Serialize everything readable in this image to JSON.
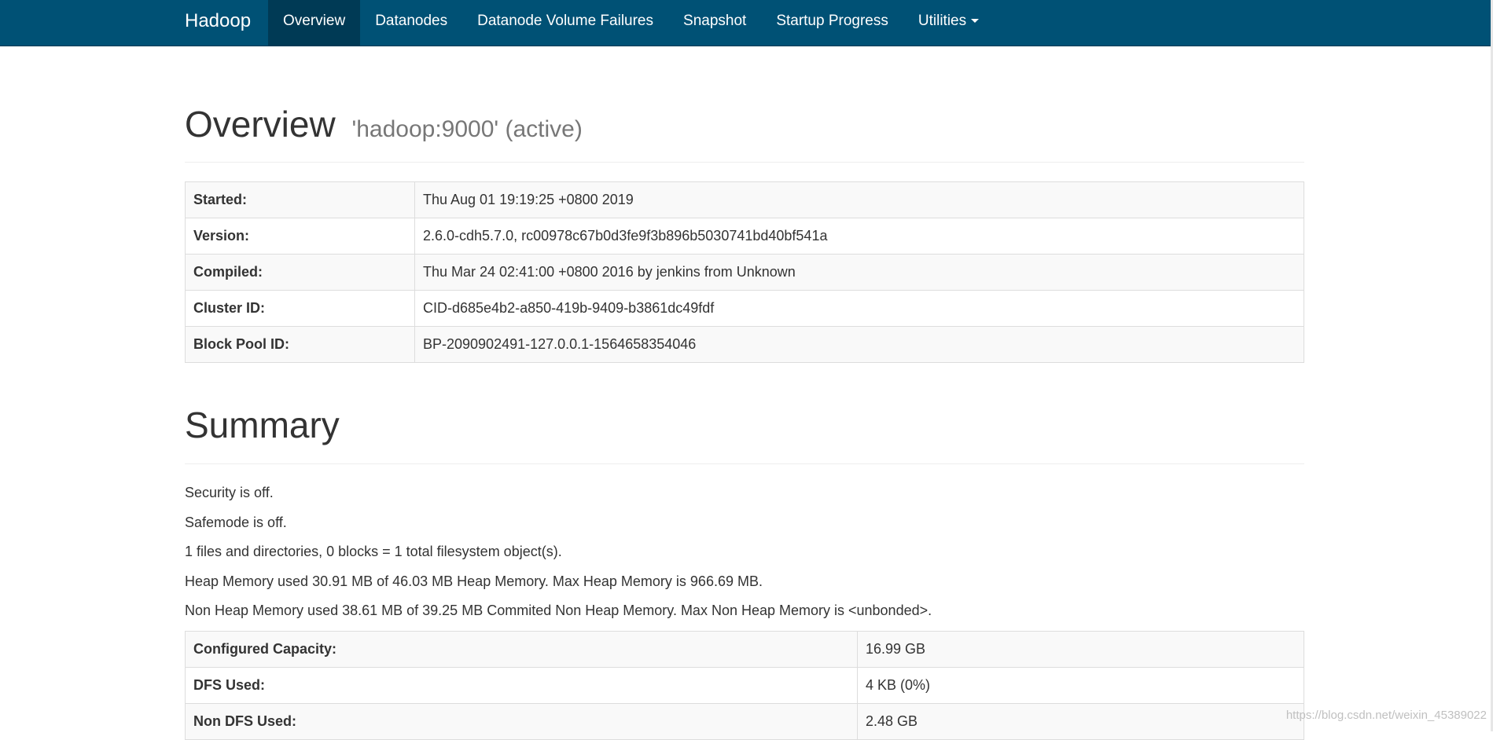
{
  "nav": {
    "brand": "Hadoop",
    "items": [
      {
        "label": "Overview",
        "active": true
      },
      {
        "label": "Datanodes",
        "active": false
      },
      {
        "label": "Datanode Volume Failures",
        "active": false
      },
      {
        "label": "Snapshot",
        "active": false
      },
      {
        "label": "Startup Progress",
        "active": false
      },
      {
        "label": "Utilities",
        "active": false,
        "dropdown": true
      }
    ]
  },
  "overview": {
    "title": "Overview",
    "subtitle": "'hadoop:9000' (active)",
    "rows": [
      {
        "label": "Started:",
        "value": "Thu Aug 01 19:19:25 +0800 2019"
      },
      {
        "label": "Version:",
        "value": "2.6.0-cdh5.7.0, rc00978c67b0d3fe9f3b896b5030741bd40bf541a"
      },
      {
        "label": "Compiled:",
        "value": "Thu Mar 24 02:41:00 +0800 2016 by jenkins from Unknown"
      },
      {
        "label": "Cluster ID:",
        "value": "CID-d685e4b2-a850-419b-9409-b3861dc49fdf"
      },
      {
        "label": "Block Pool ID:",
        "value": "BP-2090902491-127.0.0.1-1564658354046"
      }
    ]
  },
  "summary": {
    "title": "Summary",
    "lines": [
      "Security is off.",
      "Safemode is off.",
      "1 files and directories, 0 blocks = 1 total filesystem object(s).",
      "Heap Memory used 30.91 MB of 46.03 MB Heap Memory. Max Heap Memory is 966.69 MB.",
      "Non Heap Memory used 38.61 MB of 39.25 MB Commited Non Heap Memory. Max Non Heap Memory is <unbonded>."
    ],
    "capacity": [
      {
        "label": "Configured Capacity:",
        "value": "16.99 GB"
      },
      {
        "label": "DFS Used:",
        "value": "4 KB (0%)"
      },
      {
        "label": "Non DFS Used:",
        "value": "2.48 GB"
      }
    ]
  },
  "watermark": "https://blog.csdn.net/weixin_45389022",
  "colors": {
    "navbar": "#005175",
    "navbar_active": "#003a55",
    "text": "#333333",
    "muted": "#777777"
  }
}
